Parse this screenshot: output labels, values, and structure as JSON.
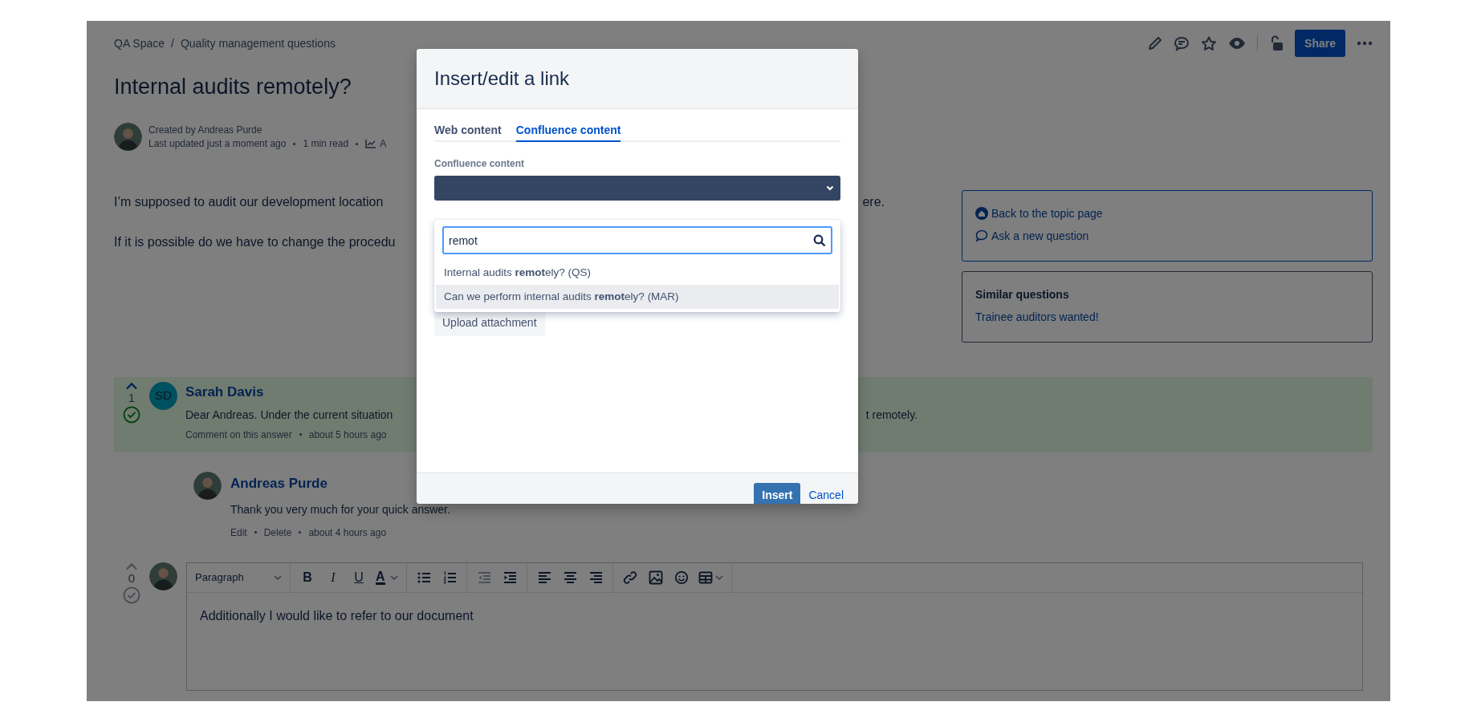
{
  "breadcrumbs": [
    "QA Space",
    "Quality management questions"
  ],
  "breadcrumb_separator": "/",
  "share_button": "Share",
  "title": "Internal audits remotely?",
  "byline": {
    "created": "Created by Andreas Purde",
    "meta": [
      "Last updated just a moment ago",
      "1 min read",
      "A"
    ]
  },
  "question": [
    {
      "left": "I’m supposed to audit our development location",
      "right": "ere."
    },
    {
      "left": "If it is possible do we have to change the procedu"
    }
  ],
  "sidebar": {
    "links": [
      {
        "kind": "home",
        "label": "Back to the topic page"
      },
      {
        "kind": "ask",
        "label": "Ask a new question"
      }
    ],
    "similar": {
      "heading": "Similar questions",
      "links": [
        "Trainee auditors wanted!"
      ]
    }
  },
  "answer": {
    "votes": "1",
    "accepted": true,
    "initials": "SD",
    "author": "Sarah Davis",
    "text_left": "Dear Andreas. Under the current situation",
    "text_right": "t remotely.",
    "meta": [
      "Comment on this answer",
      "about 5 hours ago"
    ]
  },
  "reply": {
    "author": "Andreas Purde",
    "text": "Thank you very much for your quick answer.",
    "meta": [
      "Edit",
      "Delete",
      "about 4 hours ago"
    ]
  },
  "editor": {
    "votes": "0",
    "accepted": false,
    "toolbar": [
      [
        {
          "kind": "format",
          "label": "Paragraph",
          "disabled": false
        }
      ],
      [
        {
          "kind": "bold",
          "label": "B",
          "disabled": false
        },
        {
          "kind": "italic",
          "label": "I",
          "disabled": false
        },
        {
          "kind": "underline",
          "label": "U",
          "disabled": false
        },
        {
          "kind": "color",
          "label": "A",
          "disabled": false
        }
      ],
      [
        {
          "kind": "bullets",
          "disabled": false
        },
        {
          "kind": "numbers",
          "disabled": false
        }
      ],
      [
        {
          "kind": "outdent",
          "disabled": true
        },
        {
          "kind": "indent",
          "disabled": false
        }
      ],
      [
        {
          "kind": "align-left",
          "disabled": false
        },
        {
          "kind": "align-center",
          "disabled": false
        },
        {
          "kind": "align-right",
          "disabled": false
        }
      ],
      [
        {
          "kind": "link",
          "disabled": false
        },
        {
          "kind": "image",
          "disabled": false
        },
        {
          "kind": "emoji",
          "disabled": false
        },
        {
          "kind": "table",
          "disabled": false
        }
      ]
    ],
    "content": "Additionally I would like to refer to our document"
  },
  "dialog": {
    "title": "Insert/edit a link",
    "tabs": [
      {
        "label": "Web content",
        "selected": false
      },
      {
        "label": "Confluence content",
        "selected": true
      }
    ],
    "field_label": "Confluence content",
    "search_value": "remot",
    "results": [
      {
        "text": "Internal audits **remot**ely? (QS)",
        "selected": false
      },
      {
        "text": "Can we perform internal audits **remot**ely? (MAR)",
        "selected": true
      }
    ],
    "upload_button": "Upload attachment",
    "insert_button": "Insert",
    "cancel_link": "Cancel"
  }
}
